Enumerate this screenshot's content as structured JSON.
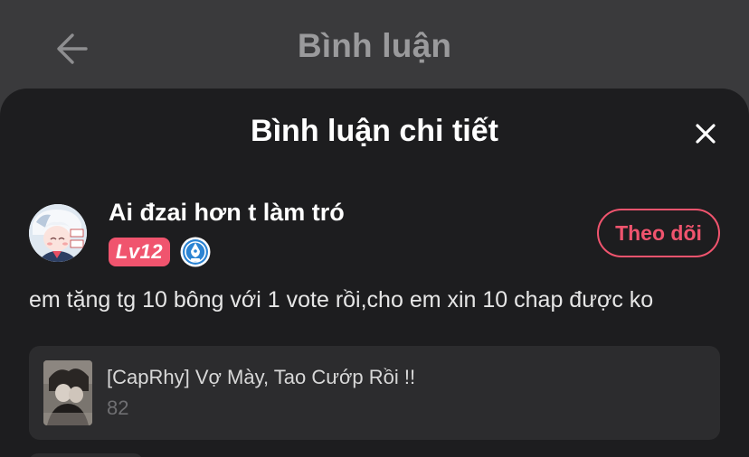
{
  "topbar": {
    "title": "Bình luận",
    "back_icon": "arrow-left-icon"
  },
  "sheet": {
    "title": "Bình luận chi tiết",
    "close_icon": "close-icon"
  },
  "comment": {
    "user_name": "Ai đzai hơn t làm tró",
    "level": "Lv12",
    "rank_icon": "quill-badge-icon",
    "follow_label": "Theo dõi",
    "text": "em tặng tg 10 bông với 1 vote rồi,cho em xin 10 chap được ko"
  },
  "story": {
    "title": "[CapRhy] Vợ Mày, Tao Cướp Rồi !!",
    "count": "82"
  },
  "colors": {
    "accent": "#f0546e",
    "sheet_bg": "#1d1d1f",
    "card_bg": "#2c2c2e",
    "overlay_bg": "#3a3a3c"
  }
}
